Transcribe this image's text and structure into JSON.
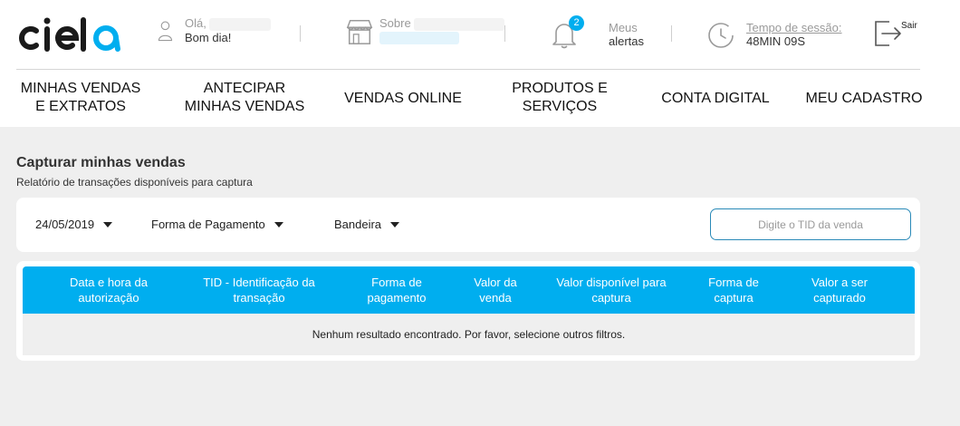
{
  "header": {
    "logo_text": "cielo",
    "greeting": "Olá,",
    "greeting_sub": "Bom dia!",
    "about_label": "Sobre",
    "alerts_count": "2",
    "alerts_line1": "Meus",
    "alerts_line2": "alertas",
    "session_label": "Tempo de sessão:",
    "session_value": "48MIN 09S",
    "logout_label": "Sair"
  },
  "nav": {
    "items": [
      {
        "line1": "MINHAS VENDAS",
        "line2": "E EXTRATOS"
      },
      {
        "line1": "ANTECIPAR",
        "line2": "MINHAS VENDAS"
      },
      {
        "line1": "VENDAS ONLINE",
        "line2": ""
      },
      {
        "line1": "PRODUTOS E",
        "line2": "SERVIÇOS"
      },
      {
        "line1": "CONTA DIGITAL",
        "line2": ""
      },
      {
        "line1": "MEU CADASTRO",
        "line2": ""
      }
    ]
  },
  "page": {
    "title": "Capturar minhas vendas",
    "subtitle": "Relatório de transações disponíveis para captura"
  },
  "filters": {
    "date": "24/05/2019",
    "payment_method": "Forma de Pagamento",
    "brand": "Bandeira",
    "tid_placeholder": "Digite o TID da venda"
  },
  "table": {
    "columns": [
      {
        "line1": "Data e hora da",
        "line2": "autorização"
      },
      {
        "line1": "TID - Identificação da",
        "line2": "transação"
      },
      {
        "line1": "Forma de",
        "line2": "pagamento"
      },
      {
        "line1": "Valor da",
        "line2": "venda"
      },
      {
        "line1": "Valor disponível para",
        "line2": "captura"
      },
      {
        "line1": "Forma de",
        "line2": "captura"
      },
      {
        "line1": "Valor a ser",
        "line2": "capturado"
      }
    ],
    "empty_message": "Nenhum resultado encontrado. Por favor, selecione outros filtros."
  },
  "colors": {
    "accent": "#00aeef",
    "brand_dark": "#1a1a1a",
    "background": "#efefef"
  }
}
